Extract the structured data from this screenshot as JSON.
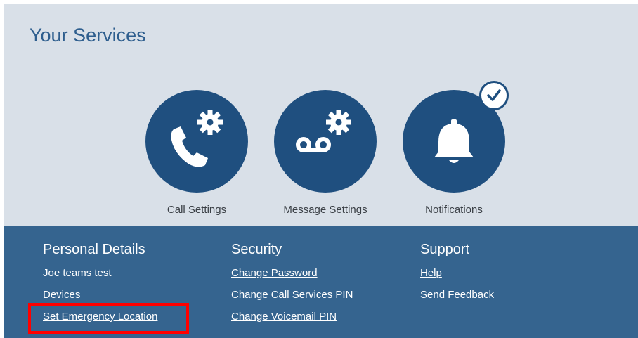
{
  "services": {
    "title": "Your Services",
    "tiles": [
      {
        "label": "Call Settings",
        "icon": "phone-gear-icon"
      },
      {
        "label": "Message Settings",
        "icon": "voicemail-gear-icon"
      },
      {
        "label": "Notifications",
        "icon": "bell-icon",
        "badge": "check-icon"
      }
    ]
  },
  "footer": {
    "personal": {
      "heading": "Personal Details",
      "items": [
        "Joe teams test",
        "Devices",
        "Set Emergency Location"
      ]
    },
    "security": {
      "heading": "Security",
      "items": [
        "Change Password",
        "Change Call Services PIN",
        "Change Voicemail PIN"
      ]
    },
    "support": {
      "heading": "Support",
      "items": [
        "Help",
        "Send Feedback"
      ]
    }
  },
  "colors": {
    "panel_bg": "#d9e0e8",
    "circle": "#1f4f7f",
    "footer_bg": "#35648f",
    "title": "#2e5e8e",
    "highlight": "#ff0000"
  }
}
